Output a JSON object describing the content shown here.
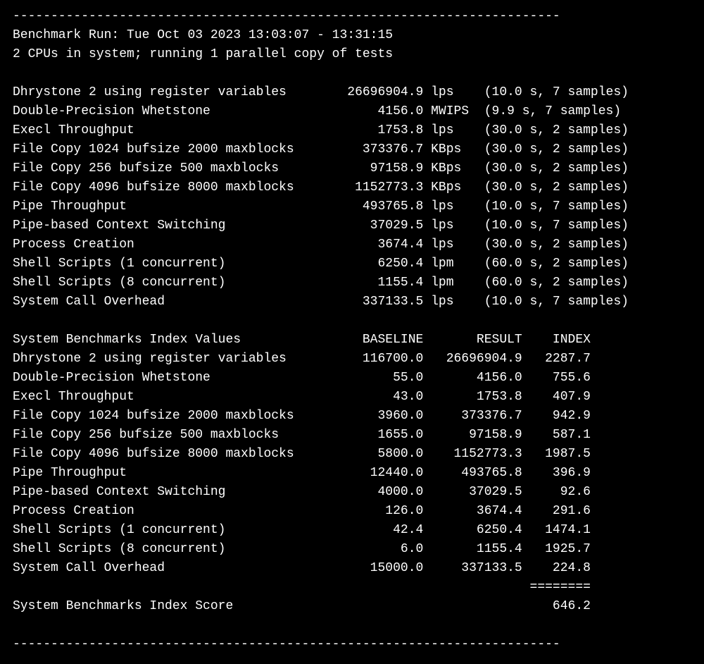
{
  "header_dashes": "------------------------------------------------------------------------",
  "run_line": "Benchmark Run: Tue Oct 03 2023 13:03:07 - 13:31:15",
  "cpu_line": "2 CPUs in system; running 1 parallel copy of tests",
  "tests": [
    {
      "name": "Dhrystone 2 using register variables",
      "value": "26696904.9",
      "unit": "lps",
      "time": "10.0",
      "samples": "7"
    },
    {
      "name": "Double-Precision Whetstone",
      "value": "4156.0",
      "unit": "MWIPS",
      "time": "9.9",
      "samples": "7"
    },
    {
      "name": "Execl Throughput",
      "value": "1753.8",
      "unit": "lps",
      "time": "30.0",
      "samples": "2"
    },
    {
      "name": "File Copy 1024 bufsize 2000 maxblocks",
      "value": "373376.7",
      "unit": "KBps",
      "time": "30.0",
      "samples": "2"
    },
    {
      "name": "File Copy 256 bufsize 500 maxblocks",
      "value": "97158.9",
      "unit": "KBps",
      "time": "30.0",
      "samples": "2"
    },
    {
      "name": "File Copy 4096 bufsize 8000 maxblocks",
      "value": "1152773.3",
      "unit": "KBps",
      "time": "30.0",
      "samples": "2"
    },
    {
      "name": "Pipe Throughput",
      "value": "493765.8",
      "unit": "lps",
      "time": "10.0",
      "samples": "7"
    },
    {
      "name": "Pipe-based Context Switching",
      "value": "37029.5",
      "unit": "lps",
      "time": "10.0",
      "samples": "7"
    },
    {
      "name": "Process Creation",
      "value": "3674.4",
      "unit": "lps",
      "time": "30.0",
      "samples": "2"
    },
    {
      "name": "Shell Scripts (1 concurrent)",
      "value": "6250.4",
      "unit": "lpm",
      "time": "60.0",
      "samples": "2"
    },
    {
      "name": "Shell Scripts (8 concurrent)",
      "value": "1155.4",
      "unit": "lpm",
      "time": "60.0",
      "samples": "2"
    },
    {
      "name": "System Call Overhead",
      "value": "337133.5",
      "unit": "lps",
      "time": "10.0",
      "samples": "7"
    }
  ],
  "index_header": {
    "label": "System Benchmarks Index Values",
    "baseline": "BASELINE",
    "result": "RESULT",
    "index": "INDEX"
  },
  "index_rows": [
    {
      "name": "Dhrystone 2 using register variables",
      "baseline": "116700.0",
      "result": "26696904.9",
      "index": "2287.7"
    },
    {
      "name": "Double-Precision Whetstone",
      "baseline": "55.0",
      "result": "4156.0",
      "index": "755.6"
    },
    {
      "name": "Execl Throughput",
      "baseline": "43.0",
      "result": "1753.8",
      "index": "407.9"
    },
    {
      "name": "File Copy 1024 bufsize 2000 maxblocks",
      "baseline": "3960.0",
      "result": "373376.7",
      "index": "942.9"
    },
    {
      "name": "File Copy 256 bufsize 500 maxblocks",
      "baseline": "1655.0",
      "result": "97158.9",
      "index": "587.1"
    },
    {
      "name": "File Copy 4096 bufsize 8000 maxblocks",
      "baseline": "5800.0",
      "result": "1152773.3",
      "index": "1987.5"
    },
    {
      "name": "Pipe Throughput",
      "baseline": "12440.0",
      "result": "493765.8",
      "index": "396.9"
    },
    {
      "name": "Pipe-based Context Switching",
      "baseline": "4000.0",
      "result": "37029.5",
      "index": "92.6"
    },
    {
      "name": "Process Creation",
      "baseline": "126.0",
      "result": "3674.4",
      "index": "291.6"
    },
    {
      "name": "Shell Scripts (1 concurrent)",
      "baseline": "42.4",
      "result": "6250.4",
      "index": "1474.1"
    },
    {
      "name": "Shell Scripts (8 concurrent)",
      "baseline": "6.0",
      "result": "1155.4",
      "index": "1925.7"
    },
    {
      "name": "System Call Overhead",
      "baseline": "15000.0",
      "result": "337133.5",
      "index": "224.8"
    }
  ],
  "score_label": "System Benchmarks Index Score",
  "score": "646.2",
  "eq_line": "========",
  "footer_dashes": "------------------------------------------------------------------------"
}
